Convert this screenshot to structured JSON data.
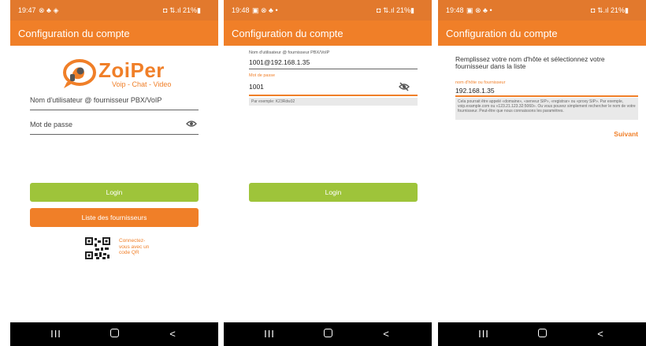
{
  "screens": [
    {
      "status": {
        "time": "19:47",
        "left_icons": "⊗ ♣ ◈",
        "right": "◘ ⇅.ıl 21%▮"
      },
      "app_title": "Configuration du compte",
      "logo": {
        "word": "ZoiPer",
        "tagline": "Voip - Chat - Video"
      },
      "username_placeholder": "Nom d'utilisateur @ fournisseur PBX/VoIP",
      "password_placeholder": "Mot de passe",
      "login_label": "Login",
      "providers_label": "Liste des fournisseurs",
      "qr_text": "Connectez-vous avec un code QR"
    },
    {
      "status": {
        "time": "19:48",
        "left_icons": "▣ ⊗ ♣ •",
        "right": "◘ ⇅.ıl 21%▮"
      },
      "app_title": "Configuration du compte",
      "username_label": "Nom d'utilisateur @ fournisseur PBX/VoIP",
      "username_value": "1001@192.168.1.35",
      "password_label": "Mot de passe",
      "password_value": "1001",
      "password_hint": "Par exemple: K23Rdw32",
      "login_label": "Login"
    },
    {
      "status": {
        "time": "19:48",
        "left_icons": "▣ ⊗ ♣ •",
        "right": "◘ ⇅.ıl 21%▮"
      },
      "app_title": "Configuration du compte",
      "heading": "Remplissez votre nom d'hôte et sélectionnez votre fournisseur dans la liste",
      "host_label": "nom d'hôte ou fournisseur",
      "host_value": "192.168.1.35",
      "help_text": "Cela pourrait être appelé «domaine», «serveur SIP», «registrar» ou «proxy SIP». Par exemple, voip.example.com ou «123.21.123.32:5060». Ou vous pouvez simplement rechercher le nom de votre fournisseur. Peut-être que nous connaissons les paramètres.",
      "next_label": "Suivant"
    }
  ],
  "navbar": {
    "recents": "III",
    "back": "<"
  },
  "colors": {
    "accent": "#f07f28",
    "statusbar": "#e2792d",
    "login": "#9ec43a",
    "navbar": "#000000"
  },
  "icons": [
    "eye-icon",
    "eye-off-icon",
    "zoiper-logo",
    "qr-code-icon",
    "home-icon",
    "recents-icon",
    "back-icon"
  ]
}
